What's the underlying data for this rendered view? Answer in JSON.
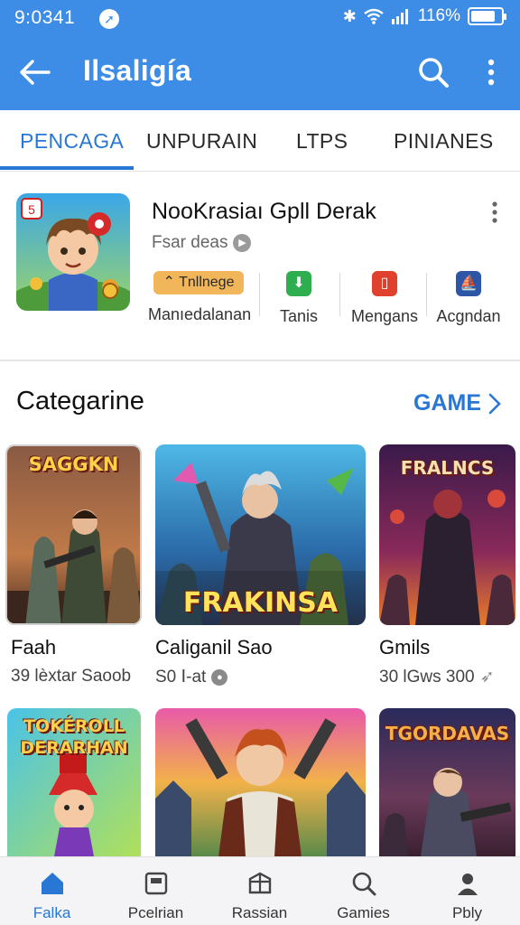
{
  "status_bar": {
    "time": "9:0341",
    "battery": "116%",
    "battery_level": 0.8
  },
  "app_bar": {
    "title": "Ilsaligía"
  },
  "tabs": [
    {
      "label": "PENCAGA",
      "active": true
    },
    {
      "label": "UNPURAIN",
      "active": false
    },
    {
      "label": "LTPS",
      "active": false
    },
    {
      "label": "PINIANES",
      "active": false
    }
  ],
  "featured": {
    "title": "NooKrasiaı Gpll Derak",
    "subtitle": "Fsar deas",
    "actions": [
      {
        "button": "Tnllnege",
        "label": "Manıedalanan"
      },
      {
        "label": "Tanis"
      },
      {
        "label": "Mengans"
      },
      {
        "label": "Acgndan"
      }
    ]
  },
  "category": {
    "title": "Categarine",
    "link": "GAME",
    "games": [
      {
        "banner": "SAGGKN",
        "name": "Faah",
        "meta": "39 lèxtar Saoob"
      },
      {
        "banner": "FRAKINSA",
        "name": "Caliganil Sao",
        "meta": "S0 Ⅰ-at"
      },
      {
        "banner": "FRALNCS",
        "name": "Gmils",
        "meta": "30 lGws 300"
      },
      {
        "banner": "TOKÉROLL DERARHAN",
        "name": "",
        "meta": ""
      },
      {
        "banner": "",
        "name": "",
        "meta": ""
      },
      {
        "banner": "TGORDAVAS",
        "name": "",
        "meta": ""
      }
    ]
  },
  "bottom_nav": [
    {
      "label": "Falka",
      "icon": "home-icon",
      "active": true
    },
    {
      "label": "Pcelrian",
      "icon": "calendar-icon",
      "active": false
    },
    {
      "label": "Rassian",
      "icon": "box-icon",
      "active": false
    },
    {
      "label": "Gamies",
      "icon": "search-icon",
      "active": false
    },
    {
      "label": "Pbly",
      "icon": "person-icon",
      "active": false
    }
  ],
  "colors": {
    "primary": "#3d8ce6",
    "accent": "#2877d4",
    "orange": "#f2b65a"
  }
}
